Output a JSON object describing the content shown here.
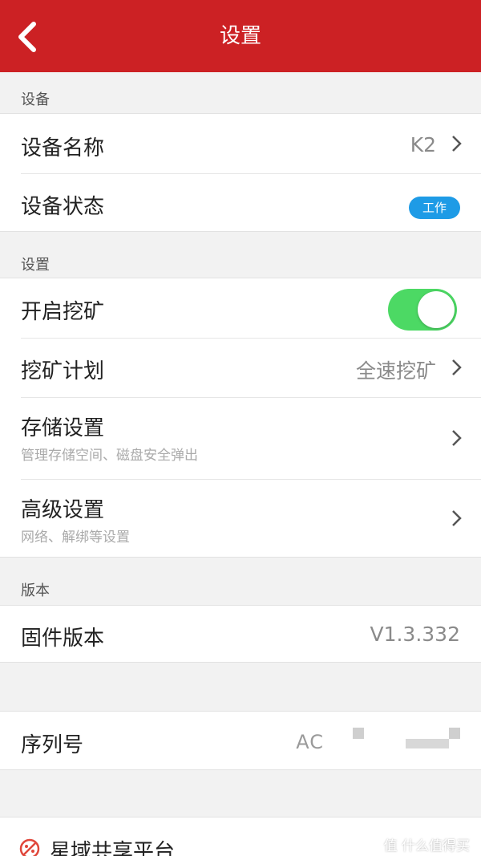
{
  "header": {
    "title": "设置"
  },
  "sections": {
    "device": {
      "label": "设备",
      "name_title": "设备名称",
      "name_value": "K2",
      "status_title": "设备状态",
      "status_badge": "工作"
    },
    "settings": {
      "label": "设置",
      "mining_title": "开启挖矿",
      "mining_enabled": true,
      "plan_title": "挖矿计划",
      "plan_value": "全速挖矿",
      "storage_title": "存储设置",
      "storage_sub": "管理存储空间、磁盘安全弹出",
      "advanced_title": "高级设置",
      "advanced_sub": "网络、解绑等设置"
    },
    "version": {
      "label": "版本",
      "firmware_title": "固件版本",
      "firmware_value": "V1.3.332",
      "serial_title": "序列号",
      "serial_value": "AC"
    }
  },
  "bottom": {
    "label": "星域共享平台"
  },
  "watermark": "值 什么值得买",
  "colors": {
    "header": "#cc2124",
    "toggle_on": "#4cd964",
    "badge": "#1e9be6"
  }
}
